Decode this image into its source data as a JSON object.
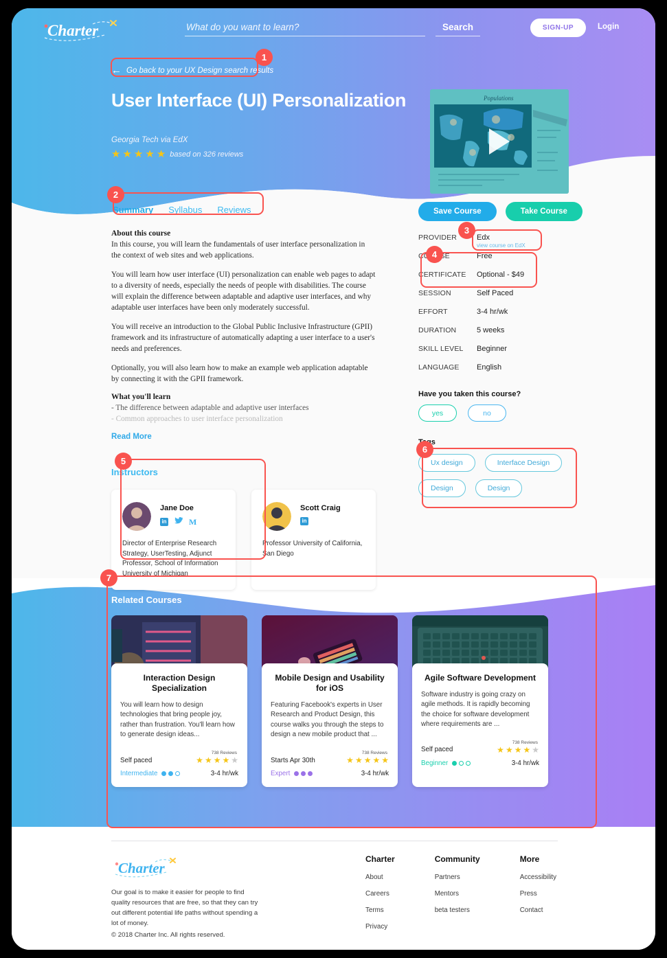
{
  "brand": {
    "name": "Charter",
    "accent_blue": "#22ace9",
    "accent_teal": "#18ceac",
    "annotation_red": "#f9534f"
  },
  "nav": {
    "search_placeholder": "What do you want to learn?",
    "search_value": "",
    "search_button": "Search",
    "signup": "SIGN-UP",
    "login": "Login"
  },
  "hero": {
    "back_link": "Go back to your UX Design search results",
    "back_arrow_icon": "arrow-left-icon",
    "title": "User Interface (UI) Personalization",
    "subtitle": "Georgia Tech via EdX",
    "stars_filled": 5,
    "stars_total": 5,
    "rating_text": "based on 326 reviews",
    "video_play_icon": "play-icon",
    "video_caption": "Populations"
  },
  "tabs": [
    {
      "label": "Summary",
      "active": true
    },
    {
      "label": "Syllabus",
      "active": false
    },
    {
      "label": "Reviews",
      "active": false
    }
  ],
  "about": {
    "heading": "About this course",
    "paragraphs": [
      "In this course, you will learn the fundamentals of user interface personalization in the context of web sites and web applications.",
      "You will learn how user interface (UI) personalization can enable web pages to adapt to a diversity of needs, especially the needs of people with disabilities. The course will explain the difference between adaptable and adaptive user interfaces, and why adaptable user interfaces have been only moderately successful.",
      "You will receive an introduction to the Global Public Inclusive Infrastructure (GPII) framework and its infrastructure of automatically adapting a user interface to a user's needs and preferences.",
      "Optionally, you will also learn how to make an example web application adaptable by connecting it with the GPII framework."
    ],
    "learn_heading": "What you'll learn",
    "learn_items": [
      "- The difference between adaptable and adaptive user interfaces",
      "- Common approaches to user interface personalization"
    ],
    "read_more": "Read More"
  },
  "actions": {
    "save": "Save Course",
    "take": "Take Course"
  },
  "details": [
    {
      "key": "PROVIDER",
      "value": "Edx",
      "sub": "view course on EdX"
    },
    {
      "key": "COURSE",
      "value": "Free",
      "sub": ""
    },
    {
      "key": "CERTIFICATE",
      "value": "Optional - $49",
      "sub": ""
    },
    {
      "key": "SESSION",
      "value": "Self Paced",
      "sub": ""
    },
    {
      "key": "EFFORT",
      "value": "3-4 hr/wk",
      "sub": ""
    },
    {
      "key": "DURATION",
      "value": "5 weeks",
      "sub": ""
    },
    {
      "key": "SKILL LEVEL",
      "value": "Beginner",
      "sub": ""
    },
    {
      "key": "LANGUAGE",
      "value": "English",
      "sub": ""
    }
  ],
  "taken": {
    "question": "Have you taken this course?",
    "yes": "yes",
    "no": "no"
  },
  "tags": {
    "label": "Tags",
    "items": [
      "Ux design",
      "Interface Design",
      "Design",
      "Design"
    ]
  },
  "instructors": {
    "heading": "Instructors",
    "list": [
      {
        "name": "Jane Doe",
        "bio": "Director of Enterprise Research Strategy, UserTesting, Adjunct Professor, School of Information University of Michigan",
        "socials": [
          "linkedin-icon",
          "twitter-icon",
          "medium-icon"
        ]
      },
      {
        "name": "Scott Craig",
        "bio": "Professor University of California, San Diego",
        "socials": [
          "linkedin-icon"
        ]
      }
    ]
  },
  "related": {
    "heading": "Related Courses",
    "cards": [
      {
        "title": "Interaction Design Specialization",
        "desc": "You will learn how to design technologies that bring people joy, rather than frustration. You'll learn how to generate design ideas...",
        "reviews": "738 Reviews",
        "stars_filled": 4,
        "stars_total": 5,
        "pacing": "Self paced",
        "level": "Intermediate",
        "level_color": "#3fb3ef",
        "dots_filled": 2,
        "dots_total": 3,
        "hours": "3-4 hr/wk"
      },
      {
        "title": "Mobile Design and Usability for iOS",
        "desc": "Featuring Facebook's experts in User Research and Product Design, this course walks you through the steps to design a new mobile product that ...",
        "reviews": "738 Reviews",
        "stars_filled": 5,
        "stars_total": 5,
        "pacing": "Starts Apr 30th",
        "level": "Expert",
        "level_color": "#9b72e8",
        "dots_filled": 3,
        "dots_total": 3,
        "hours": "3-4 hr/wk"
      },
      {
        "title": "Agile Software Development",
        "desc": "Software industry is going crazy on agile methods.  It is rapidly becoming the choice for software development where requirements are ...",
        "reviews": "738 Reviews",
        "stars_filled": 4,
        "stars_total": 5,
        "pacing": "Self paced",
        "level": "Beginner",
        "level_color": "#19cfad",
        "dots_filled": 1,
        "dots_total": 3,
        "hours": "3-4 hr/wk"
      }
    ]
  },
  "footer": {
    "mission": "Our goal is to make it easier for people to find quality resources that are free, so that they can try out different potential life paths without spending a lot of money.",
    "copyright": "© 2018 Charter Inc. All rights reserved.",
    "columns": [
      {
        "title": "Charter",
        "links": [
          "About",
          "Careers",
          "Terms",
          "Privacy"
        ]
      },
      {
        "title": "Community",
        "links": [
          "Partners",
          "Mentors",
          "beta testers"
        ]
      },
      {
        "title": "More",
        "links": [
          "Accessibility",
          "Press",
          "Contact"
        ]
      }
    ]
  },
  "annotations": [
    {
      "num": "1",
      "target": "back-link"
    },
    {
      "num": "2",
      "target": "tabs"
    },
    {
      "num": "3",
      "target": "provider-row"
    },
    {
      "num": "4",
      "target": "course-certificate-rows"
    },
    {
      "num": "5",
      "target": "instructor-card-1"
    },
    {
      "num": "6",
      "target": "tags"
    },
    {
      "num": "7",
      "target": "related-courses"
    }
  ]
}
